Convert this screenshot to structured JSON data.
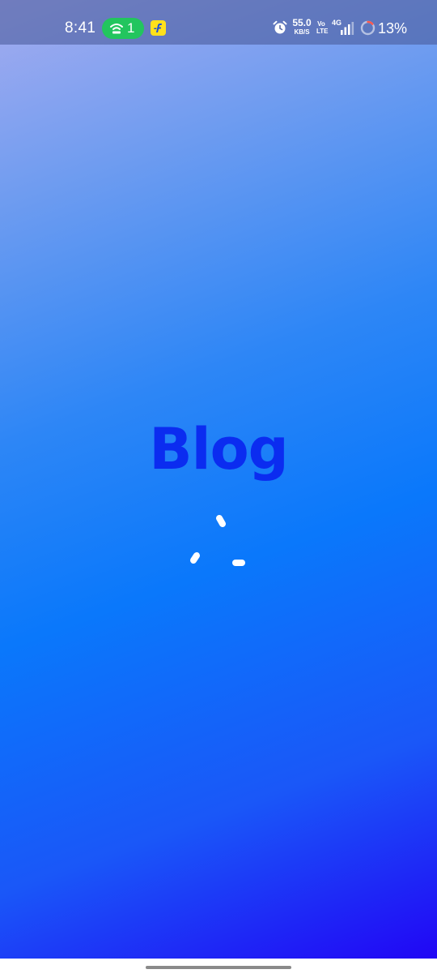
{
  "status_bar": {
    "time": "8:41",
    "hotspot_count": "1",
    "net_speed_value": "55.0",
    "net_speed_unit": "KB/S",
    "volte_top": "Vo",
    "volte_bottom": "LTE",
    "network_type": "4G",
    "battery_percent": "13%",
    "icons": [
      "hotspot-icon",
      "flipkart-icon",
      "alarm-icon",
      "signal-icon",
      "battery-ring-icon"
    ]
  },
  "splash": {
    "title": "Blog",
    "title_color": "#0b2cf0",
    "gradient_top": "#a5acef",
    "gradient_bottom": "#2106f5",
    "loading": true
  },
  "colors": {
    "hotspot_pill": "#22c55e",
    "flipkart_yellow": "#ffe11b",
    "home_indicator": "#8a8a8a"
  }
}
